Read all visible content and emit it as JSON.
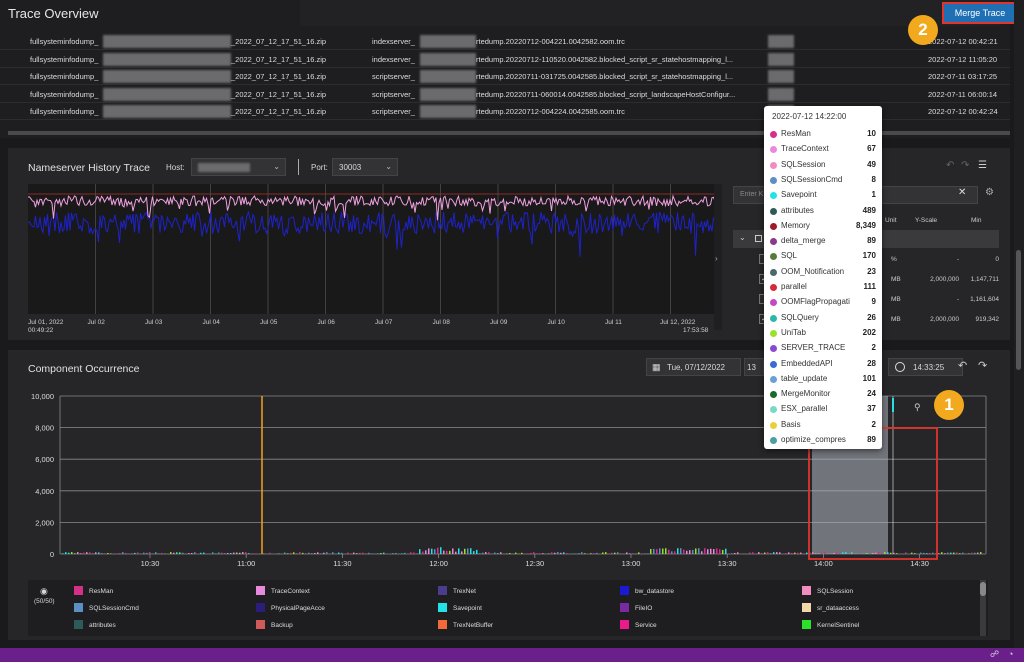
{
  "trace_overview": {
    "title": "Trace Overview",
    "merge_button": "Merge Trace",
    "rows": [
      {
        "zip": "fullsysteminfodump_",
        "zip2": "_2022_07_12_17_51_16.zip",
        "file": "indexserver_",
        "file2": "rtedump.20220712-004221.0042582.oom.trc",
        "time": "2022-07-12 00:42:21"
      },
      {
        "zip": "fullsysteminfodump_",
        "zip2": "_2022_07_12_17_51_16.zip",
        "file": "indexserver_",
        "file2": "rtedump.20220712-110520.0042582.blocked_script_sr_statehostmapping_l...",
        "time": "2022-07-12 11:05:20"
      },
      {
        "zip": "fullsysteminfodump_",
        "zip2": "_2022_07_12_17_51_16.zip",
        "file": "scriptserver_",
        "file2": "rtedump.20220711-031725.0042585.blocked_script_sr_statehostmapping_l...",
        "time": "2022-07-11 03:17:25"
      },
      {
        "zip": "fullsysteminfodump_",
        "zip2": "_2022_07_12_17_51_16.zip",
        "file": "scriptserver_",
        "file2": "rtedump.20220711-060014.0042585.blocked_script_landscapeHostConfigur...",
        "time": "2022-07-11 06:00:14"
      },
      {
        "zip": "fullsysteminfodump_",
        "zip2": "_2022_07_12_17_51_16.zip",
        "file": "scriptserver_",
        "file2": "rtedump.20220712-004224.0042585.oom.trc",
        "time": "2022-07-12 00:42:24"
      }
    ]
  },
  "nameserver": {
    "title": "Nameserver History Trace",
    "host_label": "Host:",
    "port_label": "Port:",
    "port_value": "30003",
    "x_ticks": [
      "Jul 01, 2022",
      "Jul 02",
      "Jul 03",
      "Jul 04",
      "Jul 05",
      "Jul 06",
      "Jul 07",
      "Jul 08",
      "Jul 09",
      "Jul 10",
      "Jul 11",
      "Jul 12, 2022"
    ],
    "x_tick_start_time": "00:49:22",
    "x_tick_end_time": "17:53:58",
    "kpi_placeholder": "Enter KPI",
    "columns": [
      "Unit",
      "Y-Scale",
      "Min"
    ],
    "rows": [
      {
        "unit": "%",
        "yscale": "-",
        "min": "0"
      },
      {
        "unit": "MB",
        "yscale": "2,000,000",
        "min": "1,147,711"
      },
      {
        "unit": "MB",
        "yscale": "-",
        "min": "1,161,604"
      },
      {
        "unit": "MB",
        "yscale": "2,000,000",
        "min": "919,342"
      }
    ]
  },
  "component": {
    "title": "Component Occurrence",
    "date": "Tue, 07/12/2022",
    "date_partial": "13",
    "time": "14:33:25",
    "y_ticks": [
      "10,000",
      "8,000",
      "6,000",
      "4,000",
      "2,000",
      "0"
    ],
    "x_ticks": [
      "10:30",
      "11:00",
      "11:30",
      "12:00",
      "12:30",
      "13:00",
      "13:30",
      "14:00",
      "14:30"
    ],
    "legend_count": "(50/50)",
    "legend": [
      {
        "name": "ResMan",
        "color": "#d4308a"
      },
      {
        "name": "TraceContext",
        "color": "#e88adc"
      },
      {
        "name": "TrexNet",
        "color": "#4a3d8c"
      },
      {
        "name": "bw_datastore",
        "color": "#1a1ad4"
      },
      {
        "name": "SQLSession",
        "color": "#f08cc0"
      },
      {
        "name": "SQLSessionCmd",
        "color": "#5c8fc4"
      },
      {
        "name": "PhysicalPageAcce",
        "color": "#2a1e7a"
      },
      {
        "name": "Savepoint",
        "color": "#22e2e8"
      },
      {
        "name": "FileIO",
        "color": "#7a2aa0"
      },
      {
        "name": "sr_dataaccess",
        "color": "#f2d8a8"
      },
      {
        "name": "attributes",
        "color": "#2e5a5a"
      },
      {
        "name": "Backup",
        "color": "#d05a5a"
      },
      {
        "name": "TrexNetBuffer",
        "color": "#f26a3a"
      },
      {
        "name": "Service",
        "color": "#ea1a8a"
      },
      {
        "name": "KernelSentinel",
        "color": "#2ae22a"
      }
    ]
  },
  "tooltip": {
    "time": "2022-07-12 14:22:00",
    "items": [
      {
        "name": "ResMan",
        "value": "10",
        "color": "#d4308a"
      },
      {
        "name": "TraceContext",
        "value": "67",
        "color": "#e88adc"
      },
      {
        "name": "SQLSession",
        "value": "49",
        "color": "#f08cc0"
      },
      {
        "name": "SQLSessionCmd",
        "value": "8",
        "color": "#5c8fc4"
      },
      {
        "name": "Savepoint",
        "value": "1",
        "color": "#22e2e8"
      },
      {
        "name": "attributes",
        "value": "489",
        "color": "#2e5a5a"
      },
      {
        "name": "Memory",
        "value": "8,349",
        "color": "#a01a2a"
      },
      {
        "name": "delta_merge",
        "value": "89",
        "color": "#8a3a8a"
      },
      {
        "name": "SQL",
        "value": "170",
        "color": "#5a7a3a"
      },
      {
        "name": "OOM_Notification",
        "value": "23",
        "color": "#4a6a6a"
      },
      {
        "name": "parallel",
        "value": "111",
        "color": "#d42a3a"
      },
      {
        "name": "OOMFlagPropagati",
        "value": "9",
        "color": "#c04ac8"
      },
      {
        "name": "SQLQuery",
        "value": "26",
        "color": "#2ab8a8"
      },
      {
        "name": "UniTab",
        "value": "202",
        "color": "#9ae22a"
      },
      {
        "name": "SERVER_TRACE",
        "value": "2",
        "color": "#8a4ad0"
      },
      {
        "name": "EmbeddedAPI",
        "value": "28",
        "color": "#3a6ad4"
      },
      {
        "name": "table_update",
        "value": "101",
        "color": "#6aa0d8"
      },
      {
        "name": "MergeMonitor",
        "value": "24",
        "color": "#1a6a2a"
      },
      {
        "name": "ESX_parallel",
        "value": "37",
        "color": "#7ad8c8"
      },
      {
        "name": "Basis",
        "value": "2",
        "color": "#e8d03a"
      },
      {
        "name": "optimize_compres",
        "value": "89",
        "color": "#4aa0a0"
      }
    ]
  },
  "badges": {
    "one": "1",
    "two": "2"
  }
}
